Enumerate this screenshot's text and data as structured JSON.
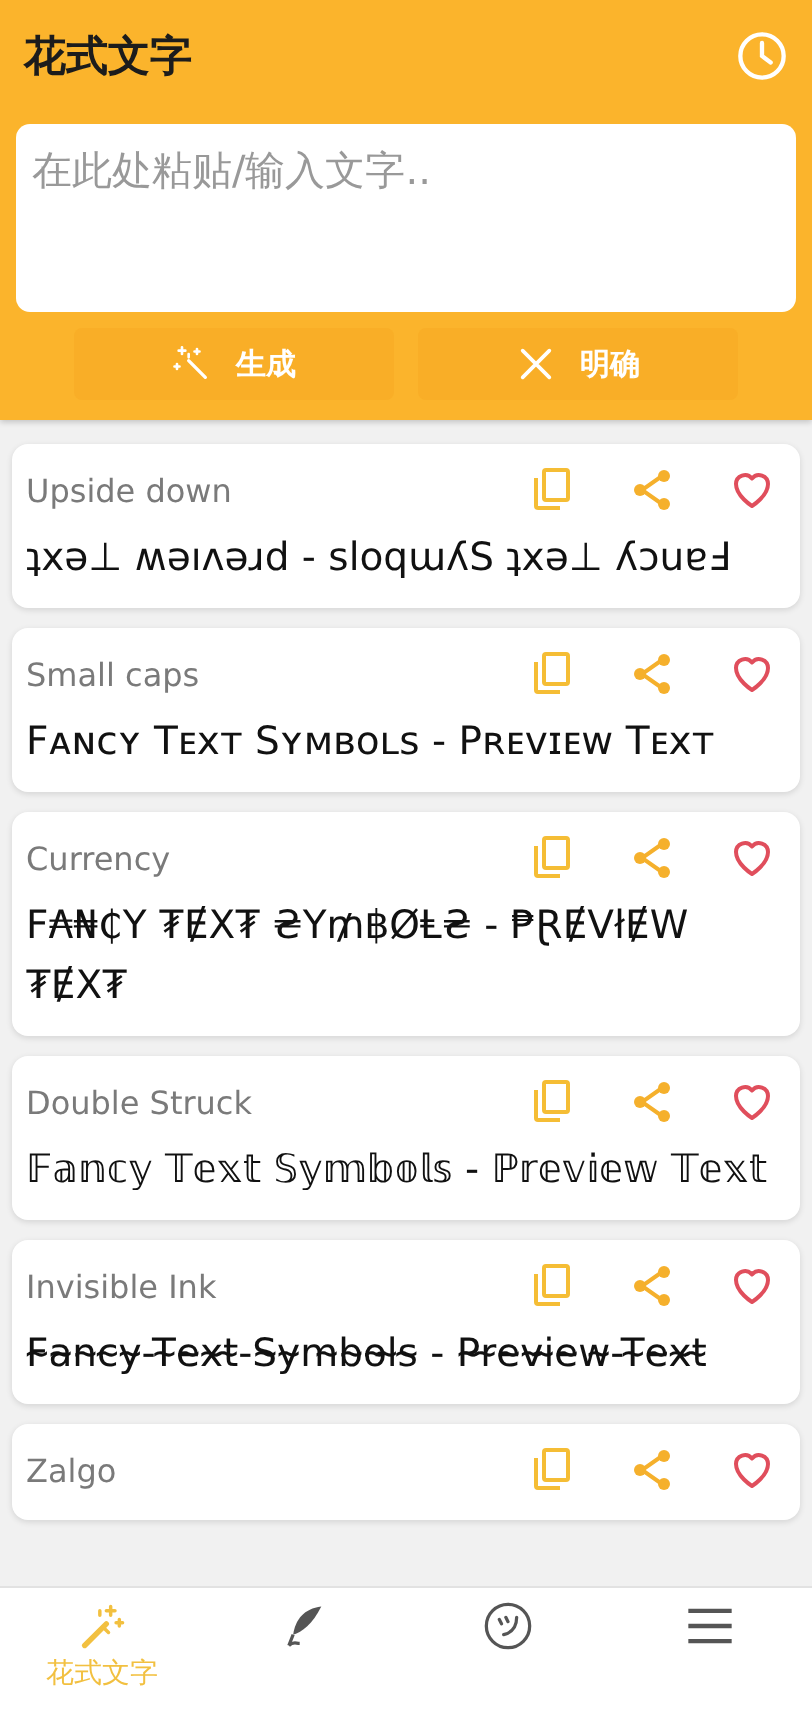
{
  "app_bar": {
    "title": "花式文字"
  },
  "input": {
    "placeholder": "在此处粘贴/输入文字.."
  },
  "buttons": [
    {
      "kind": "generate",
      "label": "生成"
    },
    {
      "kind": "clear",
      "label": "明确"
    }
  ],
  "styles": [
    {
      "name": "Upside down",
      "preview": "ʇxǝ⊥ ʍǝıʌǝɹd - sloqɯʎS ʇxǝ⊥ ʎɔuɐℲ",
      "favorite": false
    },
    {
      "name": "Small caps",
      "preview": "Fᴀɴᴄʏ Tᴇxᴛ Sʏᴍʙᴏʟs - Pʀᴇᴠɪᴇᴡ Tᴇxᴛ",
      "favorite": false
    },
    {
      "name": "Currency",
      "preview": "F₳₦₵Y ₮ɆX₮ ₴Y₥฿ØⱠ₴ - ₱ⱤɆVłɆW ₮ɆX₮",
      "favorite": false
    },
    {
      "name": "Double Struck",
      "preview": "𝔽𝕒𝕟𝕔𝕪 𝕋𝕖𝕩𝕥 𝕊𝕪𝕞𝕓𝕠𝕝𝕤 - ℙ𝕣𝕖𝕧𝕚𝕖𝕨 𝕋𝕖𝕩𝕥",
      "favorite": false
    },
    {
      "name": "Invisible Ink",
      "preview": "F̴a̴n̴c̴y̴-T̴e̴x̴t̴-S̴y̴m̴b̴o̴l̴s̴ - P̴r̴e̴v̴i̴e̴w̴-T̴e̴x̴t̴",
      "favorite": false
    },
    {
      "name": "Zalgo",
      "favorite": false
    }
  ],
  "nav": [
    {
      "kind": "wand",
      "label": "花式文字",
      "selected": true
    },
    {
      "kind": "quill",
      "selected": false
    },
    {
      "kind": "smiley",
      "selected": false
    },
    {
      "kind": "menu",
      "selected": false
    }
  ]
}
